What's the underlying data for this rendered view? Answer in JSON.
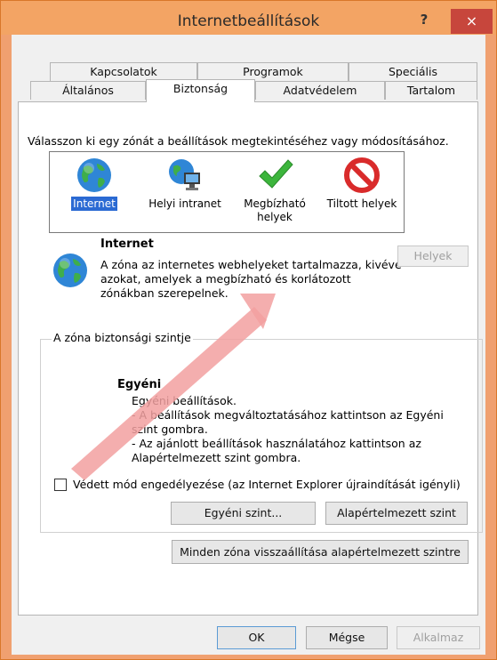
{
  "window": {
    "title": "Internetbeállítások",
    "help": "?",
    "close": "×"
  },
  "tabs_row1": [
    "Kapcsolatok",
    "Programok",
    "Speciális"
  ],
  "tabs_row2": [
    "Általános",
    "Biztonság",
    "Adatvédelem",
    "Tartalom"
  ],
  "selected_tab": "Biztonság",
  "intro": "Válasszon ki egy zónát a beállítások megtekintéséhez vagy módosításához.",
  "zones": [
    {
      "label": "Internet",
      "icon": "globe-icon",
      "selected": true
    },
    {
      "label": "Helyi intranet",
      "icon": "intranet-icon",
      "selected": false
    },
    {
      "label": "Megbízható helyek",
      "icon": "checkmark-icon",
      "selected": false
    },
    {
      "label": "Tiltott helyek",
      "icon": "prohibited-icon",
      "selected": false
    }
  ],
  "zone_info": {
    "title": "Internet",
    "description": "A zóna az internetes webhelyeket tartalmazza, kivéve azokat, amelyek a megbízható és korlátozott zónákban szerepelnek.",
    "sites_button": "Helyek"
  },
  "security_level": {
    "group_label": "A zóna biztonsági szintje",
    "title": "Egyéni",
    "lines": [
      "Egyéni beállítások.",
      "- A beállítások megváltoztatásához kattintson az Egyéni",
      "szint gombra.",
      "- Az ajánlott beállítások használatához kattintson az",
      "Alapértelmezett szint gombra."
    ],
    "protected_mode_label": "Védett mód engedélyezése (az Internet Explorer újraindítását igényli)",
    "protected_mode_checked": false,
    "custom_level_button": "Egyéni szint...",
    "default_level_button": "Alapértelmezett szint"
  },
  "reset_all_button": "Minden zóna visszaállítása alapértelmezett szintre",
  "footer": {
    "ok": "OK",
    "cancel": "Mégse",
    "apply": "Alkalmaz"
  },
  "colors": {
    "title_bar": "#f3a464",
    "close": "#c7463c",
    "selection": "#2b6ad3",
    "annotation_arrow": "#f2a0a0"
  }
}
